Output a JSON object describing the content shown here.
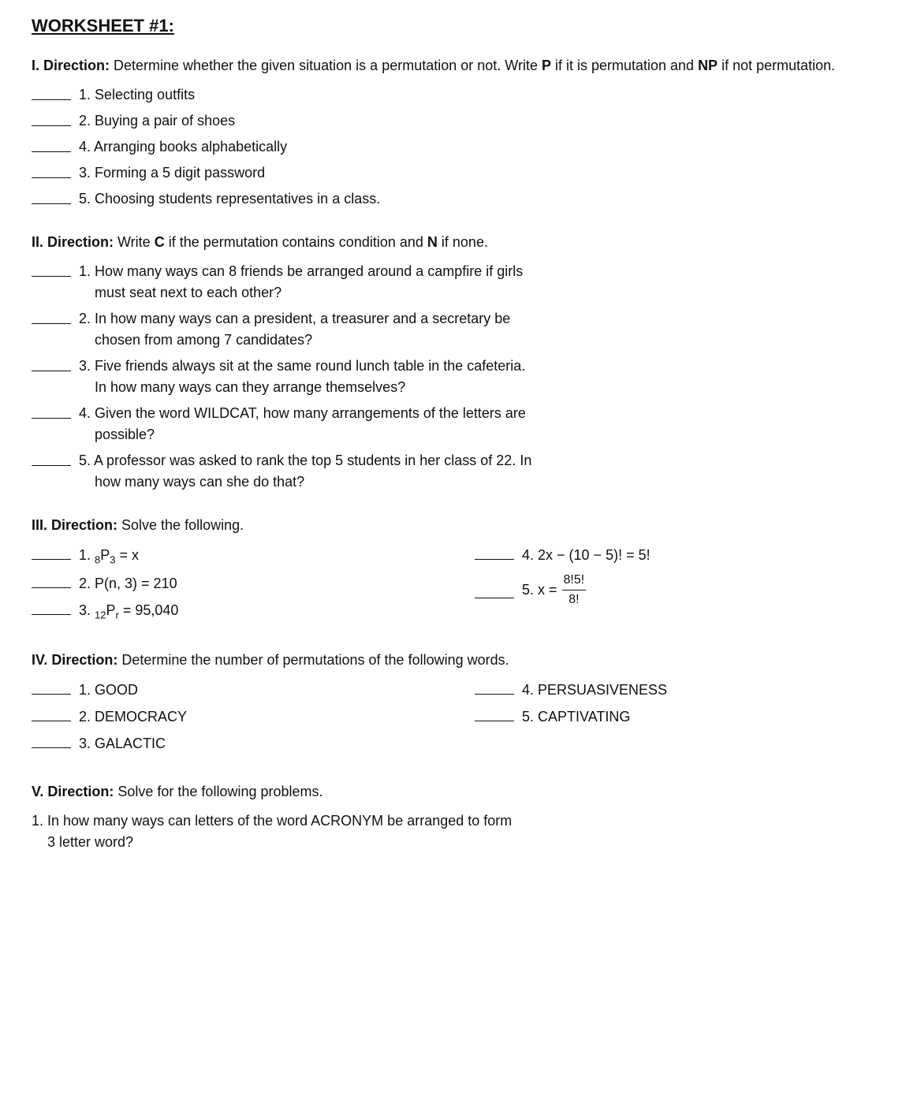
{
  "title": "WORKSHEET #1:",
  "sections": {
    "section1": {
      "label": "I.",
      "direction_bold": "Direction:",
      "direction_text": " Determine whether the given situation is a permutation or not. Write ",
      "p_bold": "P",
      "direction_text2": " if it is permutation and ",
      "np_bold": "NP",
      "direction_text3": " if not permutation.",
      "items": [
        {
          "num": "1.",
          "text": "Selecting outfits"
        },
        {
          "num": "2.",
          "text": "Buying a pair of shoes"
        },
        {
          "num": "4.",
          "text": "Arranging books alphabetically"
        },
        {
          "num": "3.",
          "text": "Forming a 5 digit password"
        },
        {
          "num": "5.",
          "text": "Choosing students representatives in a class."
        }
      ]
    },
    "section2": {
      "label": "II.",
      "direction_bold": "Direction:",
      "direction_text": " Write ",
      "c_bold": "C",
      "direction_text2": " if the permutation contains condition and ",
      "n_bold": "N",
      "direction_text3": " if none.",
      "items": [
        {
          "num": "1.",
          "text": "How many ways can 8 friends be arranged around a campfire if girls must seat next to each other?"
        },
        {
          "num": "2.",
          "text": "In how many ways can a president, a treasurer and a secretary be chosen from among 7 candidates?"
        },
        {
          "num": "3.",
          "text": "Five friends always sit at the same round lunch table in the cafeteria. In how many ways can they arrange themselves?"
        },
        {
          "num": "4.",
          "text": "Given the word WILDCAT, how many arrangements of the letters are possible?"
        },
        {
          "num": "5.",
          "text": "A professor was asked to rank the top 5 students in her class of 22. In how many ways can she do that?"
        }
      ]
    },
    "section3": {
      "label": "III.",
      "direction_bold": "Direction:",
      "direction_text": " Solve the following.",
      "left_items": [
        {
          "num": "1.",
          "math": "₈P₃ = x"
        },
        {
          "num": "2.",
          "math": "P(n, 3) = 210"
        },
        {
          "num": "3.",
          "math": "₁₂Pᵣ = 95,040"
        }
      ],
      "right_items": [
        {
          "num": "4.",
          "math": "2x − (10 − 5)! = 5!"
        },
        {
          "num": "5.",
          "math": "x = 8!5!/8!",
          "has_frac": true
        }
      ]
    },
    "section4": {
      "label": "IV.",
      "direction_bold": "Direction:",
      "direction_text": " Determine the number of permutations of the following words.",
      "left_items": [
        {
          "num": "1.",
          "text": "GOOD"
        },
        {
          "num": "2.",
          "text": "DEMOCRACY"
        },
        {
          "num": "3.",
          "text": "GALACTIC"
        }
      ],
      "right_items": [
        {
          "num": "4.",
          "text": "PERSUASIVENESS"
        },
        {
          "num": "5.",
          "text": "CAPTIVATING"
        }
      ]
    },
    "section5": {
      "label": "V.",
      "direction_bold": "Direction:",
      "direction_text": " Solve for the following problems.",
      "items": [
        {
          "num": "1.",
          "text": "In how many ways can letters of the word ACRONYM be arranged to form 3 letter word?"
        }
      ]
    }
  }
}
